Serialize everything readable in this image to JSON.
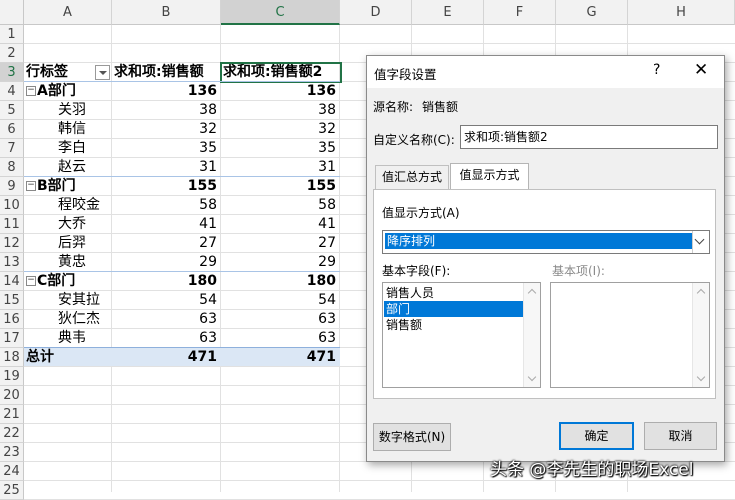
{
  "columns": [
    "A",
    "B",
    "C",
    "D",
    "E",
    "F",
    "G",
    "H"
  ],
  "rows": [
    "1",
    "2",
    "3",
    "4",
    "5",
    "6",
    "7",
    "8",
    "9",
    "10",
    "11",
    "12",
    "13",
    "14",
    "15",
    "16",
    "17",
    "18",
    "19",
    "20",
    "21",
    "22",
    "23",
    "24",
    "25"
  ],
  "pivot": {
    "header": {
      "label": "行标签",
      "col1": "求和项:销售额",
      "col2": "求和项:销售额2"
    },
    "groups": [
      {
        "name": "A部门",
        "v1": "136",
        "v2": "136",
        "members": [
          {
            "name": "关羽",
            "v1": "38",
            "v2": "38"
          },
          {
            "name": "韩信",
            "v1": "32",
            "v2": "32"
          },
          {
            "name": "李白",
            "v1": "35",
            "v2": "35"
          },
          {
            "name": "赵云",
            "v1": "31",
            "v2": "31"
          }
        ]
      },
      {
        "name": "B部门",
        "v1": "155",
        "v2": "155",
        "members": [
          {
            "name": "程咬金",
            "v1": "58",
            "v2": "58"
          },
          {
            "name": "大乔",
            "v1": "41",
            "v2": "41"
          },
          {
            "name": "后羿",
            "v1": "27",
            "v2": "27"
          },
          {
            "name": "黄忠",
            "v1": "29",
            "v2": "29"
          }
        ]
      },
      {
        "name": "C部门",
        "v1": "180",
        "v2": "180",
        "members": [
          {
            "name": "安其拉",
            "v1": "54",
            "v2": "54"
          },
          {
            "name": "狄仁杰",
            "v1": "63",
            "v2": "63"
          },
          {
            "name": "典韦",
            "v1": "63",
            "v2": "63"
          }
        ]
      }
    ],
    "total": {
      "label": "总计",
      "v1": "471",
      "v2": "471"
    },
    "collapse_glyph": "⊟"
  },
  "dialog": {
    "title": "值字段设置",
    "help_label": "?",
    "close_label": "✕",
    "source_label": "源名称:",
    "source_value": "销售额",
    "custom_label": "自定义名称(C):",
    "custom_value": "求和项:销售额2",
    "tabs": [
      {
        "label": "值汇总方式",
        "active": false
      },
      {
        "label": "值显示方式",
        "active": true
      }
    ],
    "show_as_label": "值显示方式(A)",
    "show_as_value": "降序排列",
    "base_field_label": "基本字段(F):",
    "base_item_label": "基本项(I):",
    "base_fields": [
      {
        "label": "销售人员",
        "selected": false
      },
      {
        "label": "部门",
        "selected": true
      },
      {
        "label": "销售额",
        "selected": false
      }
    ],
    "number_format_label": "数字格式(N)",
    "ok_label": "确定",
    "cancel_label": "取消"
  },
  "watermark": "头条 @李先生的职场Excel"
}
